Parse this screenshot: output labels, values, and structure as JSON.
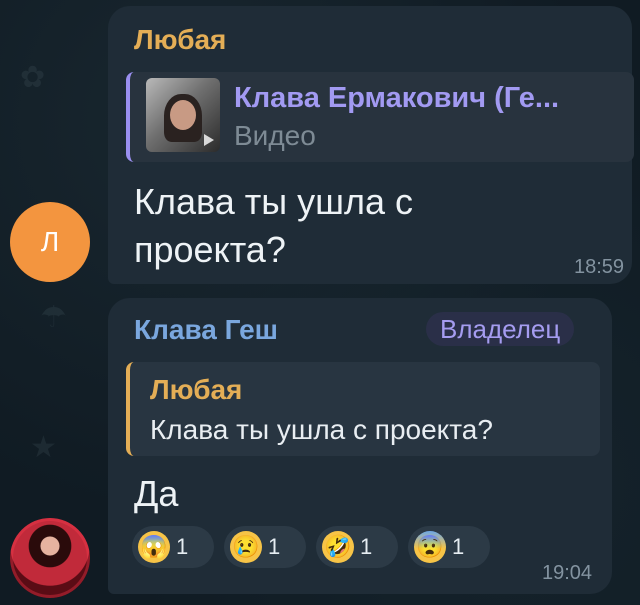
{
  "messages": [
    {
      "sender": "Любая",
      "avatar_letter": "Л",
      "reply": {
        "title": "Клава Ермакович (Ге...",
        "subtitle": "Видео",
        "media_icon": "video-thumbnail"
      },
      "text": "Клава ты ушла с проекта?",
      "time": "18:59",
      "sender_color": "#e4ae56"
    },
    {
      "sender": "Клава Геш",
      "badge": "Владелец",
      "reply": {
        "title": "Любая",
        "subtitle": "Клава ты ушла с проекта?"
      },
      "text": "Да",
      "time": "19:04",
      "sender_color": "#7aa7de",
      "reactions": [
        {
          "emoji": "😱",
          "icon": "screaming-face-icon",
          "count": "1"
        },
        {
          "emoji": "😢",
          "icon": "crying-face-icon",
          "count": "1"
        },
        {
          "emoji": "🤣",
          "icon": "rolling-laughing-face-icon",
          "count": "1"
        },
        {
          "emoji": "😨",
          "icon": "fearful-face-icon",
          "count": "1"
        }
      ]
    }
  ],
  "colors": {
    "background": "#101b23",
    "bubble": "#1f2c37",
    "avatar_orange": "#f3953f",
    "reply_accent": "#9a8ff0",
    "owner_badge": "#a59cf0"
  }
}
